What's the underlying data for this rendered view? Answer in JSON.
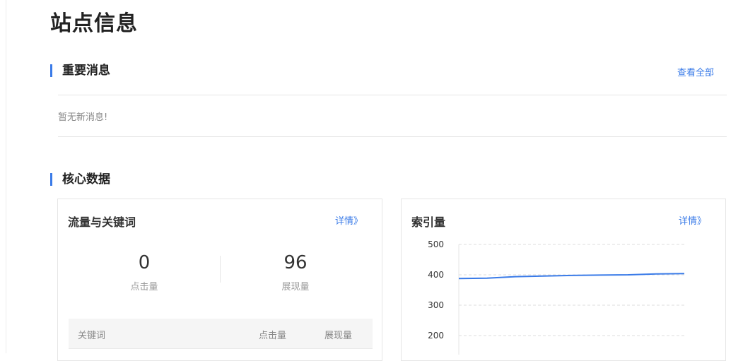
{
  "page": {
    "title": "站点信息"
  },
  "messages": {
    "heading": "重要消息",
    "view_all": "查看全部",
    "empty_text": "暂无新消息!"
  },
  "core": {
    "heading": "核心数据",
    "traffic_card": {
      "title": "流量与关键词",
      "details_link": "详情》",
      "metrics": [
        {
          "value": "0",
          "label": "点击量"
        },
        {
          "value": "96",
          "label": "展现量"
        }
      ],
      "table_headers": [
        "关键词",
        "点击量",
        "展现量"
      ]
    },
    "index_card": {
      "title": "索引量",
      "details_link": "详情》"
    }
  },
  "colors": {
    "accent": "#3a7be8",
    "line": "#3a7be8"
  },
  "chart_data": {
    "type": "line",
    "title": "",
    "xlabel": "",
    "ylabel": "",
    "y_ticks": [
      "500",
      "400",
      "300",
      "200"
    ],
    "ylim": [
      200,
      500
    ],
    "grid": true,
    "series": [
      {
        "values": [
          388,
          389,
          394,
          396,
          398,
          399,
          400,
          403,
          404
        ]
      }
    ]
  }
}
